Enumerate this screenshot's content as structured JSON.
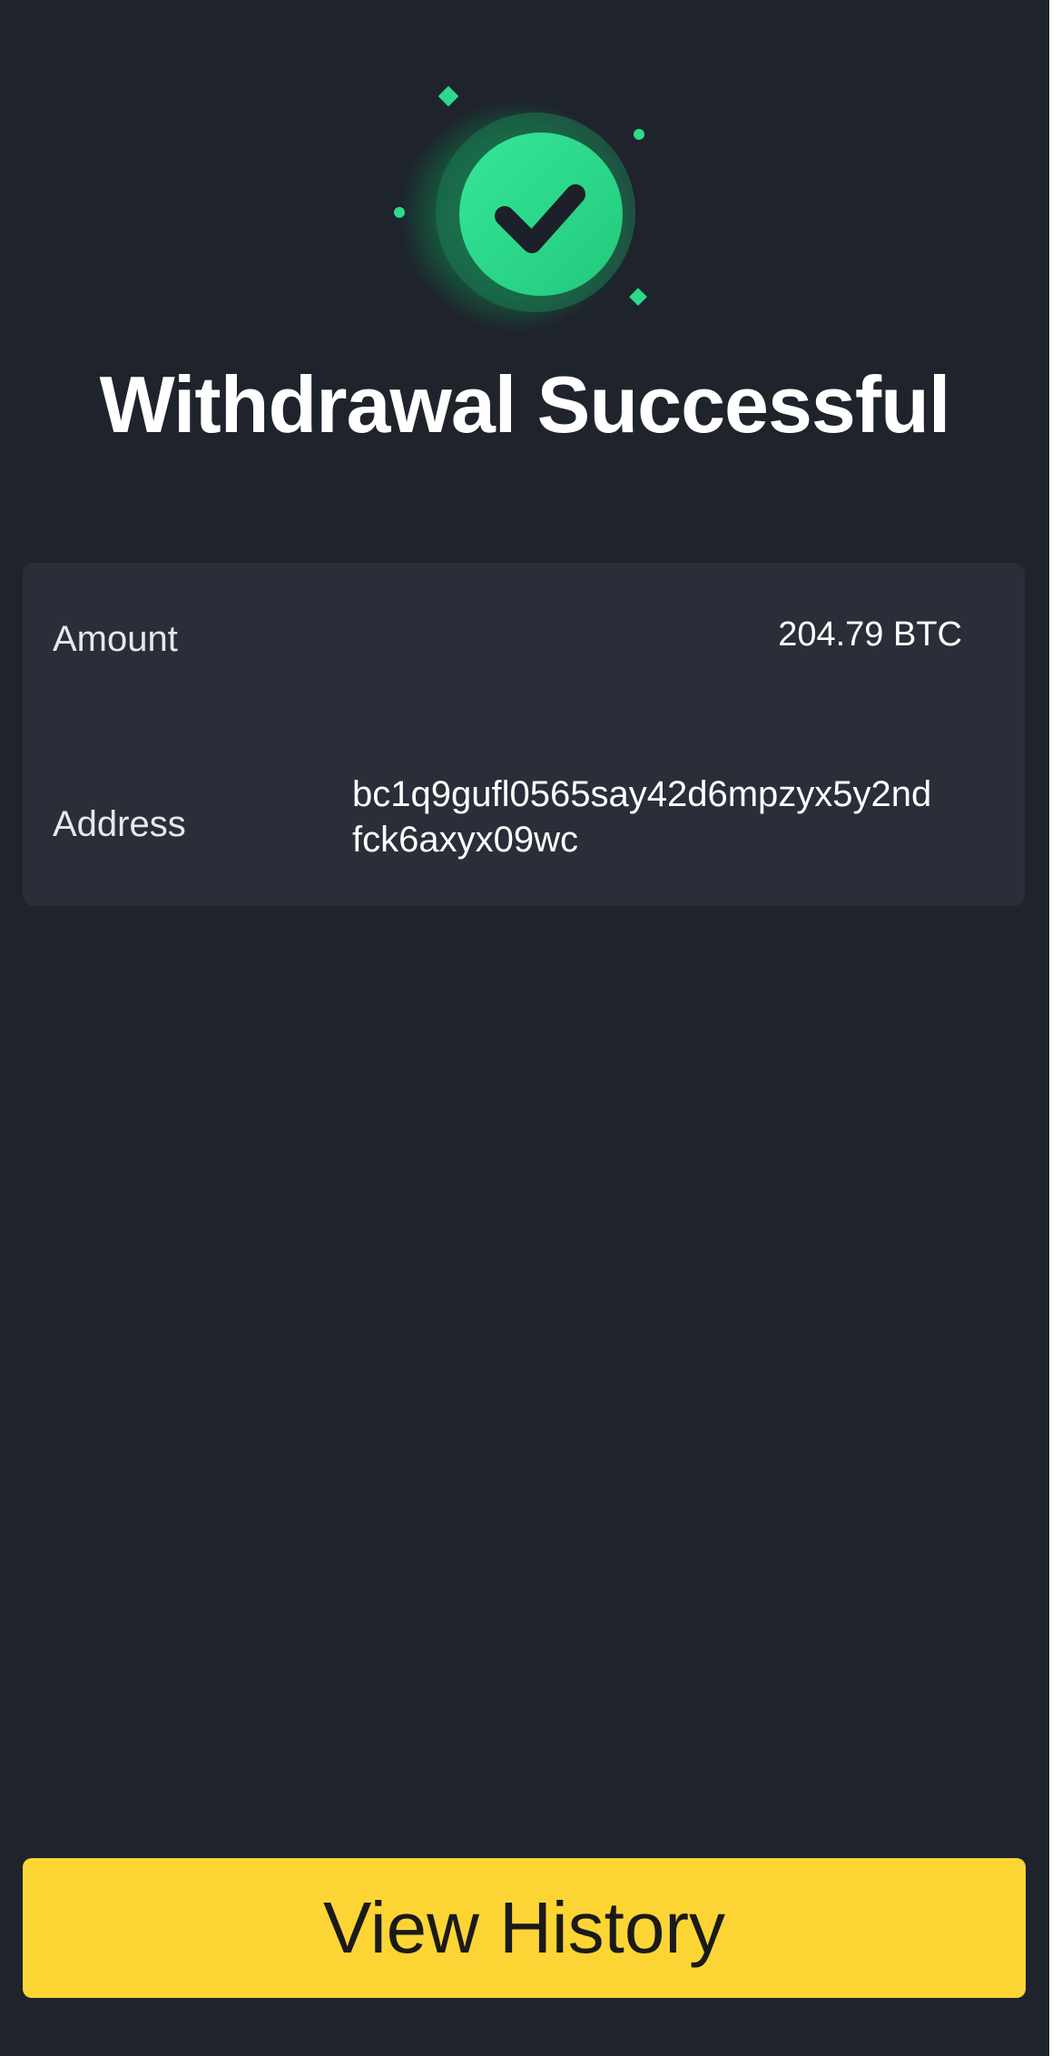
{
  "status": {
    "icon": "check-circle-icon",
    "title": "Withdrawal Successful"
  },
  "details": {
    "amount_label": "Amount",
    "amount_value": "204.79 BTC",
    "address_label": "Address",
    "address_value": "bc1q9gufl0565say42d6mpzyx5y2ndfck6axyx09wc",
    "address_lines": [
      "bc1q9gufl0565say42d6mpzyx5y2nd",
      "fck6axyx09wc"
    ]
  },
  "actions": {
    "view_history_label": "View History"
  },
  "colors": {
    "background": "#1f232c",
    "card": "#2a2e38",
    "success_green": "#2ed98a",
    "button_yellow": "#fcd535"
  }
}
